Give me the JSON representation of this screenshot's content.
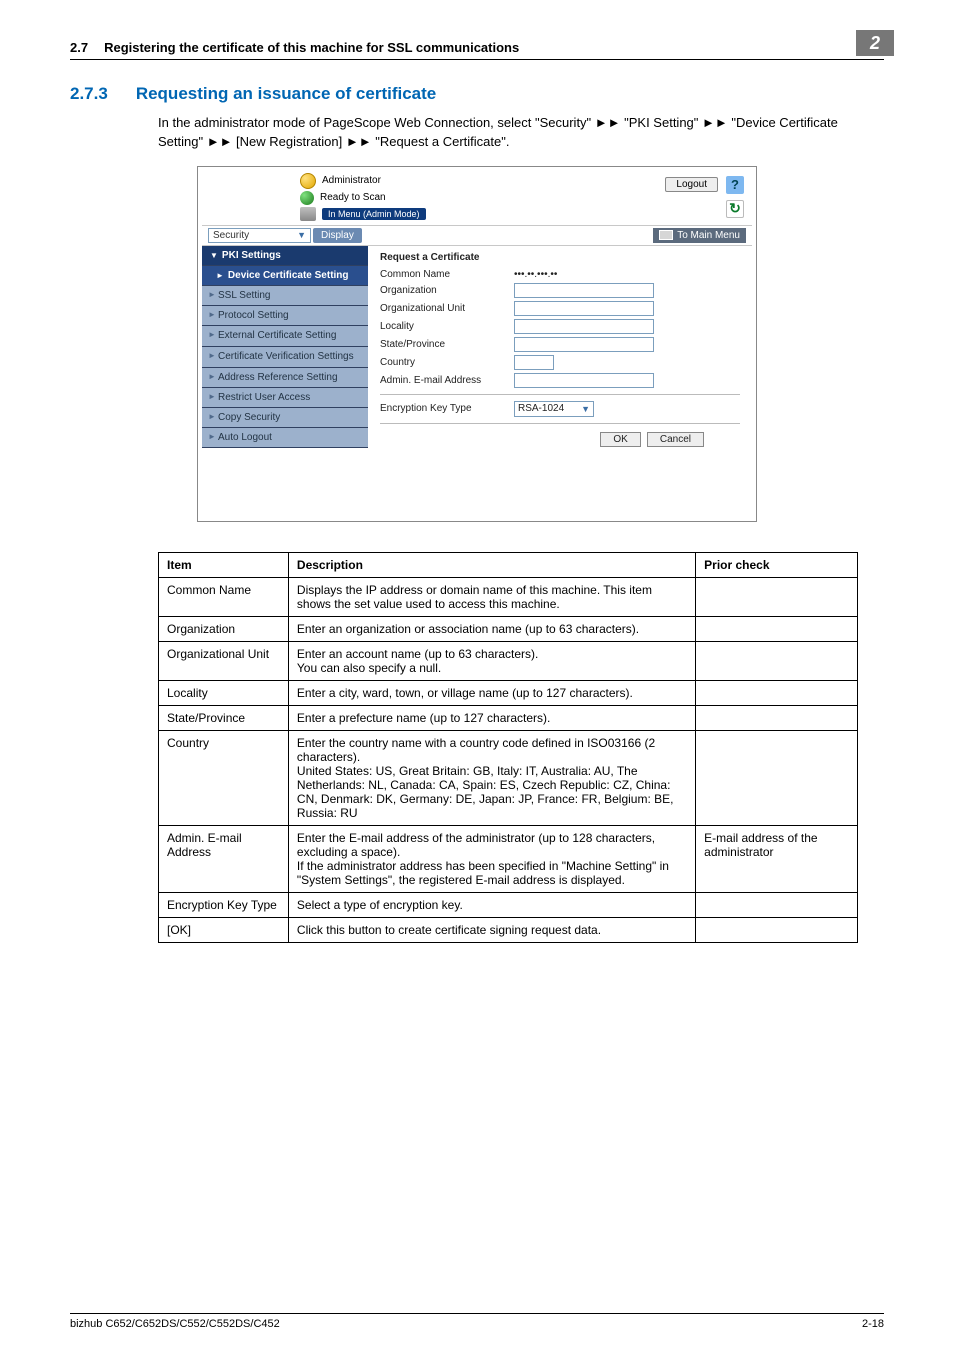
{
  "header": {
    "section_num": "2.7",
    "section_title": "Registering the certificate of this machine for SSL communications",
    "corner": "2"
  },
  "section": {
    "num": "2.7.3",
    "title": "Requesting an issuance of certificate"
  },
  "intro": "In the administrator mode of PageScope Web Connection, select \"Security\" ►► \"PKI Setting\" ►► \"Device Certificate Setting\" ►► [New Registration] ►► \"Request a Certificate\".",
  "shot": {
    "administrator": "Administrator",
    "ready": "Ready to Scan",
    "menu_mode": "In Menu (Admin Mode)",
    "logout": "Logout",
    "help": "?",
    "refresh": "↻",
    "dropdown": "Security",
    "display": "Display",
    "to_main": "To Main Menu",
    "side": {
      "s0": "PKI Settings",
      "s1": "Device Certificate Setting",
      "s2": "SSL Setting",
      "s3": "Protocol Setting",
      "s4": "External Certificate Setting",
      "s5": "Certificate Verification Settings",
      "s6": "Address Reference Setting",
      "s7": "Restrict User Access",
      "s8": "Copy Security",
      "s9": "Auto Logout"
    },
    "form": {
      "title": "Request a Certificate",
      "f0": "Common Name",
      "f1": "Organization",
      "f2": "Organizational Unit",
      "f3": "Locality",
      "f4": "State/Province",
      "f5": "Country",
      "f6": "Admin. E-mail Address",
      "f7": "Encryption Key Type",
      "key_val": "RSA-1024",
      "ok": "OK",
      "cancel": "Cancel"
    }
  },
  "table": {
    "h_item": "Item",
    "h_desc": "Description",
    "h_prior": "Prior check",
    "rows": [
      {
        "item": "Common Name",
        "desc": "Displays the IP address or domain name of this machine. This item shows the set value used to access this machine.",
        "prior": ""
      },
      {
        "item": "Organization",
        "desc": "Enter an organization or association name (up to 63 characters).",
        "prior": ""
      },
      {
        "item": "Organizational Unit",
        "desc": "Enter an account name (up to 63 characters).\nYou can also specify a null.",
        "prior": ""
      },
      {
        "item": "Locality",
        "desc": "Enter a city, ward, town, or village name (up to 127 characters).",
        "prior": ""
      },
      {
        "item": "State/Province",
        "desc": "Enter a prefecture name (up to 127 characters).",
        "prior": ""
      },
      {
        "item": "Country",
        "desc": "Enter the country name with a country code defined in ISO03166 (2 characters).\nUnited States: US, Great Britain: GB, Italy: IT, Australia: AU, The Netherlands: NL, Canada: CA, Spain: ES, Czech Republic: CZ, China: CN, Denmark: DK, Germany: DE, Japan: JP, France: FR, Belgium: BE, Russia: RU",
        "prior": ""
      },
      {
        "item": "Admin. E-mail Address",
        "desc": "Enter the E-mail address of the administrator (up to 128 characters, excluding a space).\nIf the administrator address has been specified in \"Machine Setting\" in \"System Settings\", the registered E-mail address is displayed.",
        "prior": "E-mail address of the administrator"
      },
      {
        "item": "Encryption Key Type",
        "desc": "Select a type of encryption key.",
        "prior": ""
      },
      {
        "item": "[OK]",
        "desc": "Click this button to create certificate signing request data.",
        "prior": ""
      }
    ]
  },
  "footer": {
    "left": "bizhub C652/C652DS/C552/C552DS/C452",
    "right": "2-18"
  }
}
